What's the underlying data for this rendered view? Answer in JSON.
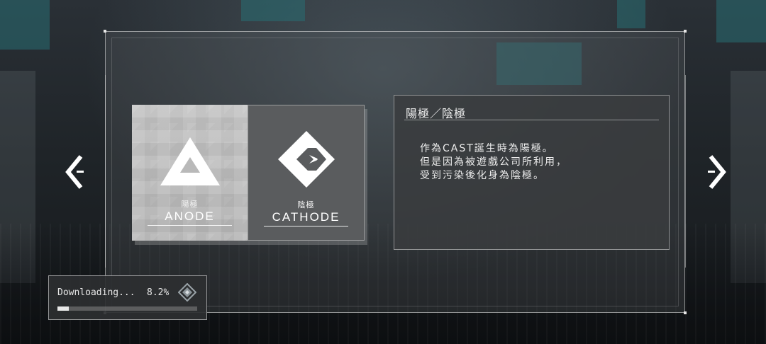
{
  "options": [
    {
      "sub": "陽極",
      "label": "ANODE",
      "icon": "anode-triangle-icon",
      "selected": true
    },
    {
      "sub": "陰極",
      "label": "CATHODE",
      "icon": "cathode-diamond-icon",
      "selected": false
    }
  ],
  "description": {
    "title": "陽極／陰極",
    "lines": [
      "作為CAST誕生時為陽極。",
      "但是因為被遊戲公司所利用，",
      "受到污染後化身為陰極。"
    ]
  },
  "navigation": {
    "prev_icon": "chevron-left-icon",
    "next_icon": "chevron-right-icon"
  },
  "download": {
    "label": "Downloading...",
    "percent_text": "8.2%",
    "progress": 0.082,
    "icon": "diamond-emblem-icon"
  }
}
